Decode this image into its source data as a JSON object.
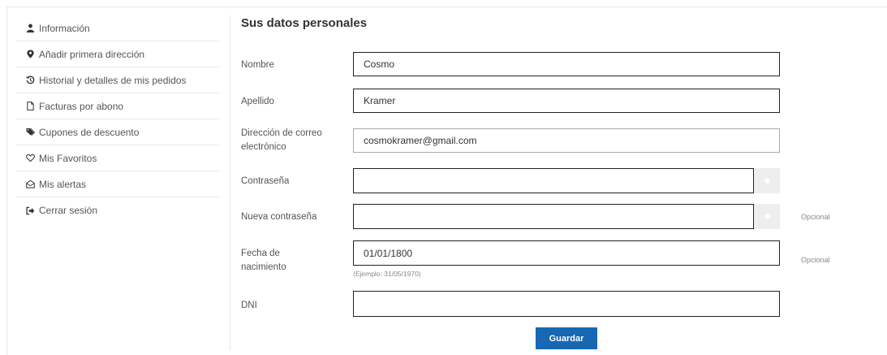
{
  "sidebar": {
    "items": [
      {
        "label": "Información",
        "icon": "user-icon"
      },
      {
        "label": "Añadir primera dirección",
        "icon": "map-marker-icon"
      },
      {
        "label": "Historial y detalles de mis pedidos",
        "icon": "history-icon"
      },
      {
        "label": "Facturas por abono",
        "icon": "file-icon"
      },
      {
        "label": "Cupones de descuento",
        "icon": "tags-icon"
      },
      {
        "label": "Mis Favoritos",
        "icon": "heart-icon"
      },
      {
        "label": "Mis alertas",
        "icon": "envelope-icon"
      },
      {
        "label": "Cerrar sesión",
        "icon": "sign-out-icon"
      }
    ]
  },
  "main": {
    "title": "Sus datos personales",
    "fields": {
      "nombre": {
        "label": "Nombre",
        "value": "Cosmo"
      },
      "apellido": {
        "label": "Apellido",
        "value": "Kramer"
      },
      "email": {
        "label": "Dirección de correo electrónico",
        "value": "cosmokramer@gmail.com"
      },
      "password": {
        "label": "Contraseña",
        "value": ""
      },
      "new_password": {
        "label": "Nueva contraseña",
        "value": "",
        "optional": "Opcional"
      },
      "birthdate": {
        "label": "Fecha de nacimiento",
        "value": "01/01/1800",
        "hint": "(Ejemplo: 31/05/1970)",
        "optional": "Opcional"
      },
      "dni": {
        "label": "DNI",
        "value": ""
      }
    },
    "save_label": "Guardar"
  },
  "colors": {
    "accent": "#1767b3",
    "border": "#222222",
    "eye_button_bg": "#eeeeee"
  }
}
